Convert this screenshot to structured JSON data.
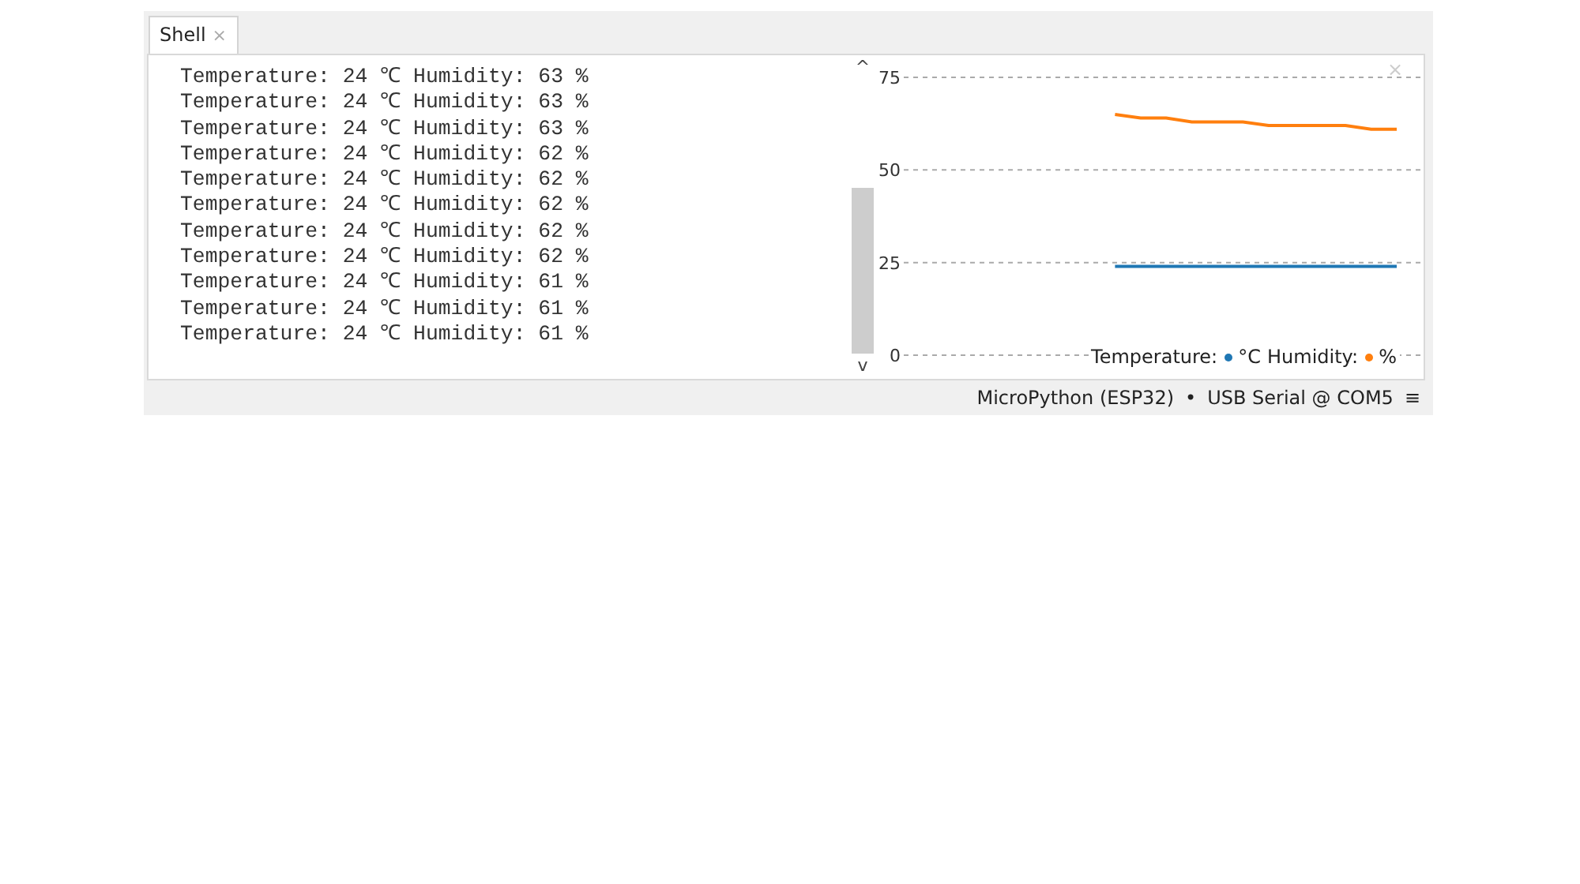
{
  "tabs": [
    {
      "label": "Shell",
      "close": "×",
      "selected": true
    }
  ],
  "shell": {
    "lines": [
      "Temperature: 24 ℃ Humidity: 63 %",
      "Temperature: 24 ℃ Humidity: 63 %",
      "Temperature: 24 ℃ Humidity: 63 %",
      "Temperature: 24 ℃ Humidity: 62 %",
      "Temperature: 24 ℃ Humidity: 62 %",
      "Temperature: 24 ℃ Humidity: 62 %",
      "Temperature: 24 ℃ Humidity: 62 %",
      "Temperature: 24 ℃ Humidity: 62 %",
      "Temperature: 24 ℃ Humidity: 61 %",
      "Temperature: 24 ℃ Humidity: 61 %",
      "Temperature: 24 ℃ Humidity: 61 %"
    ],
    "scroll_up": "^",
    "scroll_down": "v"
  },
  "plotter": {
    "close": "×",
    "legend": [
      {
        "suffix": "°C"
      },
      {
        "suffix": "%"
      }
    ],
    "chart_data": {
      "type": "line",
      "categories": [
        null,
        null,
        null,
        null,
        null,
        null,
        null,
        null,
        null,
        null,
        null,
        null,
        null,
        null,
        null,
        null,
        null,
        null,
        null,
        null
      ],
      "ylim": [
        0,
        75
      ],
      "grid": true,
      "legend": "lower right",
      "yticks": [
        {
          "value": 0,
          "label": "0"
        },
        {
          "value": 25,
          "label": "25"
        },
        {
          "value": 50,
          "label": "50"
        },
        {
          "value": 75,
          "label": "75"
        }
      ],
      "series": [
        {
          "name": "Temperature:",
          "color": "#1f77b4",
          "values": [
            null,
            null,
            null,
            null,
            null,
            null,
            null,
            null,
            24,
            24,
            24,
            24,
            24,
            24,
            24,
            24,
            24,
            24,
            24,
            24
          ]
        },
        {
          "name": "Humidity:",
          "color": "#ff7f0e",
          "values": [
            null,
            null,
            null,
            null,
            null,
            null,
            null,
            null,
            65,
            64,
            64,
            63,
            63,
            63,
            62,
            62,
            62,
            62,
            61,
            61
          ]
        }
      ]
    }
  },
  "status_bar": {
    "interpreter": "MicroPython (ESP32)",
    "separator": "•",
    "port": "USB Serial @ COM5",
    "menu": "≡"
  }
}
